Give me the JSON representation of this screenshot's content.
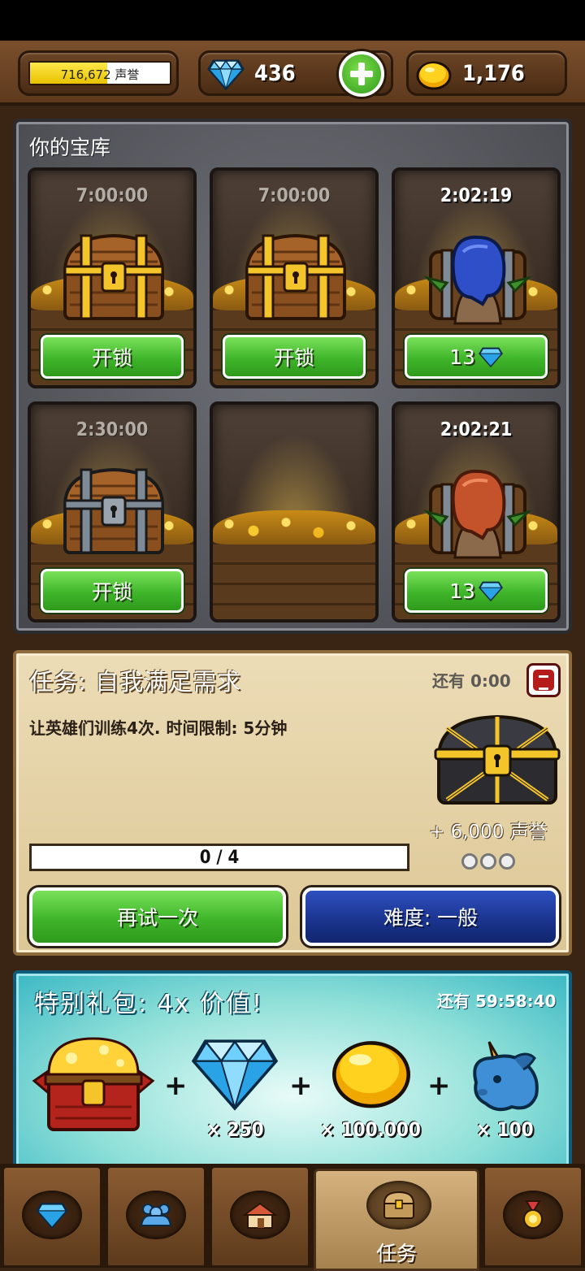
{
  "topbar": {
    "reputation": {
      "value": "716,672",
      "label": "声誉",
      "fill_fraction": 0.55
    },
    "gems": {
      "value": "436",
      "icon": "diamond-icon"
    },
    "add_gems": {
      "icon": "plus-icon"
    },
    "coins": {
      "value": "1,176",
      "icon": "gold-coin-icon"
    }
  },
  "vault": {
    "title": "你的宝库",
    "slots": [
      {
        "timer": "7:00:00",
        "chest": "wooden-gold-chest",
        "button": "开锁"
      },
      {
        "timer": "7:00:00",
        "chest": "wooden-gold-chest",
        "button": "开锁"
      },
      {
        "timer": "2:02:19",
        "chest": "hooded-goblin-chest",
        "button": "13",
        "button_icon": "diamond-icon"
      },
      {
        "timer": "2:30:00",
        "chest": "wooden-iron-chest",
        "button": "开锁"
      },
      {
        "timer": "",
        "chest": "empty",
        "button": ""
      },
      {
        "timer": "2:02:21",
        "chest": "hooded-goblin-chest-orange",
        "button": "13",
        "button_icon": "diamond-icon"
      }
    ]
  },
  "quest": {
    "title": "任务: 自我满足需求",
    "remaining": "还有 0:00",
    "description": "让英雄们训练4次. 时间限制: 5分钟",
    "reward": "+ 6,000 声誉",
    "progress_text": "0 / 4",
    "progress_fraction": 0,
    "retry_label": "再试一次",
    "difficulty_label": "难度: 一般",
    "colors": {
      "retry": "#3fb52a",
      "difficulty": "#1b3590"
    }
  },
  "offer": {
    "title": "特别礼包:  4x 价值!",
    "remaining": "还有 59:58:40",
    "items": [
      {
        "icon": "red-treasure-chest-icon",
        "qty": ""
      },
      {
        "icon": "diamond-icon",
        "qty": "× 250"
      },
      {
        "icon": "gold-coin-icon",
        "qty": "× 100.000"
      },
      {
        "icon": "unicorn-icon",
        "qty": "× 100"
      }
    ],
    "plus": "+"
  },
  "nav": {
    "tabs": [
      {
        "icon": "gem-shop-icon",
        "label": ""
      },
      {
        "icon": "heroes-icon",
        "label": ""
      },
      {
        "icon": "town-icon",
        "label": ""
      },
      {
        "icon": "chest-icon",
        "label": "任务",
        "active": true
      },
      {
        "icon": "medal-icon",
        "label": ""
      }
    ]
  }
}
